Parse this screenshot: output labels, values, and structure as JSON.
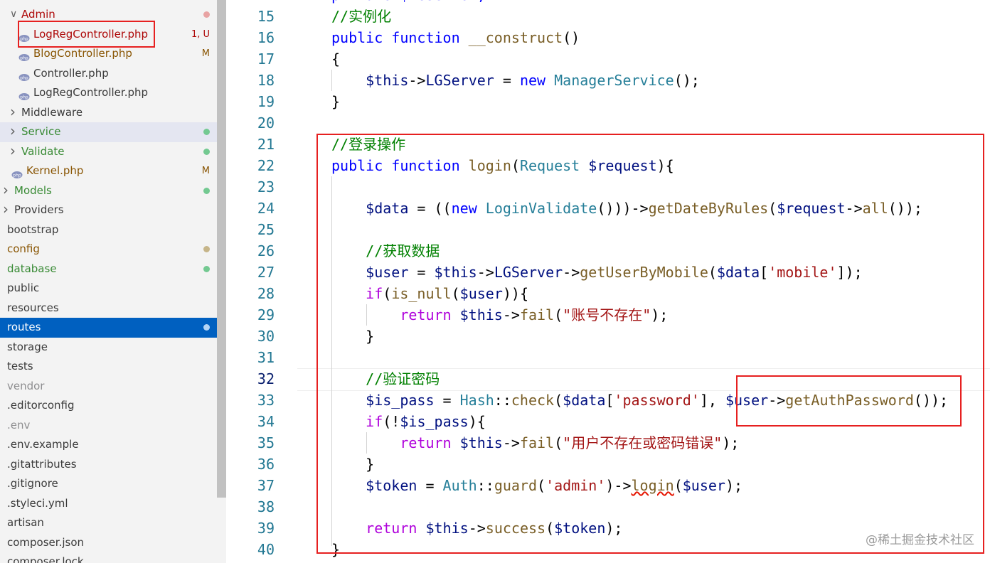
{
  "sidebar": {
    "items": [
      {
        "label": "Admin",
        "indent": 1,
        "chevron": "down",
        "color": "#ad0707",
        "dot": "#e8a3a3"
      },
      {
        "label": "LogRegController.php",
        "indent": 2,
        "icon": "php-icon",
        "color": "#ad0707",
        "badge": "1, U"
      },
      {
        "label": "BlogController.php",
        "indent": 2,
        "icon": "php-icon",
        "color": "#895503",
        "badge": "M"
      },
      {
        "label": "Controller.php",
        "indent": 2,
        "icon": "php-icon"
      },
      {
        "label": "LogRegController.php",
        "indent": 2,
        "icon": "php-icon"
      },
      {
        "label": "Middleware",
        "indent": 1,
        "chevron": "right"
      },
      {
        "label": "Service",
        "indent": 1,
        "chevron": "right",
        "color": "#388a34",
        "dot": "#73c991"
      },
      {
        "label": "Validate",
        "indent": 1,
        "chevron": "right",
        "color": "#388a34",
        "dot": "#73c991"
      },
      {
        "label": "Kernel.php",
        "indent": 1,
        "icon": "php-icon",
        "color": "#895503",
        "badge": "M"
      },
      {
        "label": "Models",
        "indent": 0,
        "chevron": "right",
        "color": "#388a34",
        "dot": "#73c991"
      },
      {
        "label": "Providers",
        "indent": 0,
        "chevron": "right"
      },
      {
        "label": "bootstrap",
        "indent": 0
      },
      {
        "label": "config",
        "indent": 0,
        "color": "#895503",
        "dot": "#c6b589"
      },
      {
        "label": "database",
        "indent": 0,
        "color": "#388a34",
        "dot": "#73c991"
      },
      {
        "label": "public",
        "indent": 0
      },
      {
        "label": "resources",
        "indent": 0
      },
      {
        "label": "routes",
        "indent": 0,
        "selected": true,
        "dot": "#b3d4f5"
      },
      {
        "label": "storage",
        "indent": 0
      },
      {
        "label": "tests",
        "indent": 0
      },
      {
        "label": "vendor",
        "indent": 0,
        "color": "#8e8e90"
      },
      {
        "label": ".editorconfig",
        "indent": 0
      },
      {
        "label": ".env",
        "indent": 0,
        "color": "#8e8e90"
      },
      {
        "label": ".env.example",
        "indent": 0
      },
      {
        "label": ".gitattributes",
        "indent": 0
      },
      {
        "label": ".gitignore",
        "indent": 0
      },
      {
        "label": ".styleci.yml",
        "indent": 0
      },
      {
        "label": "artisan",
        "indent": 0
      },
      {
        "label": "composer.json",
        "indent": 0
      },
      {
        "label": "composer.lock",
        "indent": 0
      }
    ]
  },
  "editor": {
    "lines": [
      {
        "num": "14",
        "tokens": [
          {
            "t": "private $LGServer;",
            "c": "kw"
          }
        ]
      },
      {
        "num": "15",
        "tokens": [
          {
            "t": "//实例化",
            "c": "cm"
          }
        ]
      },
      {
        "num": "16",
        "tokens": [
          {
            "t": "public",
            "c": "kw"
          },
          {
            "t": " "
          },
          {
            "t": "function",
            "c": "kw"
          },
          {
            "t": " "
          },
          {
            "t": "__construct",
            "c": "fn"
          },
          {
            "t": "()"
          }
        ]
      },
      {
        "num": "17",
        "tokens": [
          {
            "t": "{"
          }
        ]
      },
      {
        "num": "18",
        "tokens": [
          {
            "t": "    "
          },
          {
            "t": "$this",
            "c": "var"
          },
          {
            "t": "->"
          },
          {
            "t": "LGServer",
            "c": "var"
          },
          {
            "t": " = "
          },
          {
            "t": "new",
            "c": "kw"
          },
          {
            "t": " "
          },
          {
            "t": "ManagerService",
            "c": "cls"
          },
          {
            "t": "();"
          }
        ]
      },
      {
        "num": "19",
        "tokens": [
          {
            "t": "}"
          }
        ]
      },
      {
        "num": "20",
        "tokens": []
      },
      {
        "num": "21",
        "tokens": [
          {
            "t": "//登录操作",
            "c": "cm"
          }
        ]
      },
      {
        "num": "22",
        "tokens": [
          {
            "t": "public",
            "c": "kw"
          },
          {
            "t": " "
          },
          {
            "t": "function",
            "c": "kw"
          },
          {
            "t": " "
          },
          {
            "t": "login",
            "c": "fn"
          },
          {
            "t": "("
          },
          {
            "t": "Request",
            "c": "cls"
          },
          {
            "t": " "
          },
          {
            "t": "$request",
            "c": "var"
          },
          {
            "t": "){"
          }
        ]
      },
      {
        "num": "23",
        "tokens": []
      },
      {
        "num": "24",
        "tokens": [
          {
            "t": "    "
          },
          {
            "t": "$data",
            "c": "var"
          },
          {
            "t": " = (("
          },
          {
            "t": "new",
            "c": "kw"
          },
          {
            "t": " "
          },
          {
            "t": "LoginValidate",
            "c": "cls"
          },
          {
            "t": "()))->"
          },
          {
            "t": "getDateByRules",
            "c": "fn"
          },
          {
            "t": "("
          },
          {
            "t": "$request",
            "c": "var"
          },
          {
            "t": "->"
          },
          {
            "t": "all",
            "c": "fn"
          },
          {
            "t": "());"
          }
        ]
      },
      {
        "num": "25",
        "tokens": []
      },
      {
        "num": "26",
        "tokens": [
          {
            "t": "    "
          },
          {
            "t": "//获取数据",
            "c": "cm"
          }
        ]
      },
      {
        "num": "27",
        "tokens": [
          {
            "t": "    "
          },
          {
            "t": "$user",
            "c": "var"
          },
          {
            "t": " = "
          },
          {
            "t": "$this",
            "c": "var"
          },
          {
            "t": "->"
          },
          {
            "t": "LGServer",
            "c": "var"
          },
          {
            "t": "->"
          },
          {
            "t": "getUserByMobile",
            "c": "fn"
          },
          {
            "t": "("
          },
          {
            "t": "$data",
            "c": "var"
          },
          {
            "t": "["
          },
          {
            "t": "'mobile'",
            "c": "str"
          },
          {
            "t": "]);"
          }
        ]
      },
      {
        "num": "28",
        "tokens": [
          {
            "t": "    "
          },
          {
            "t": "if",
            "c": "kw2"
          },
          {
            "t": "("
          },
          {
            "t": "is_null",
            "c": "fn"
          },
          {
            "t": "("
          },
          {
            "t": "$user",
            "c": "var"
          },
          {
            "t": ")){"
          }
        ]
      },
      {
        "num": "29",
        "tokens": [
          {
            "t": "        "
          },
          {
            "t": "return",
            "c": "kw2"
          },
          {
            "t": " "
          },
          {
            "t": "$this",
            "c": "var"
          },
          {
            "t": "->"
          },
          {
            "t": "fail",
            "c": "fn"
          },
          {
            "t": "("
          },
          {
            "t": "\"账号不存在\"",
            "c": "str"
          },
          {
            "t": ");"
          }
        ]
      },
      {
        "num": "30",
        "tokens": [
          {
            "t": "    }"
          }
        ]
      },
      {
        "num": "31",
        "tokens": []
      },
      {
        "num": "32",
        "tokens": [
          {
            "t": "    "
          },
          {
            "t": "//验证密码",
            "c": "cm"
          }
        ]
      },
      {
        "num": "33",
        "tokens": [
          {
            "t": "    "
          },
          {
            "t": "$is_pass",
            "c": "var"
          },
          {
            "t": " = "
          },
          {
            "t": "Hash",
            "c": "cls"
          },
          {
            "t": "::"
          },
          {
            "t": "check",
            "c": "fn"
          },
          {
            "t": "("
          },
          {
            "t": "$data",
            "c": "var"
          },
          {
            "t": "["
          },
          {
            "t": "'password'",
            "c": "str"
          },
          {
            "t": "], "
          },
          {
            "t": "$user",
            "c": "var"
          },
          {
            "t": "->"
          },
          {
            "t": "getAuthPassword",
            "c": "fn"
          },
          {
            "t": "());"
          }
        ]
      },
      {
        "num": "34",
        "tokens": [
          {
            "t": "    "
          },
          {
            "t": "if",
            "c": "kw2"
          },
          {
            "t": "(!"
          },
          {
            "t": "$is_pass",
            "c": "var"
          },
          {
            "t": "){"
          }
        ]
      },
      {
        "num": "35",
        "tokens": [
          {
            "t": "        "
          },
          {
            "t": "return",
            "c": "kw2"
          },
          {
            "t": " "
          },
          {
            "t": "$this",
            "c": "var"
          },
          {
            "t": "->"
          },
          {
            "t": "fail",
            "c": "fn"
          },
          {
            "t": "("
          },
          {
            "t": "\"用户不存在或密码错误\"",
            "c": "str"
          },
          {
            "t": ");"
          }
        ]
      },
      {
        "num": "36",
        "tokens": [
          {
            "t": "    }"
          }
        ]
      },
      {
        "num": "37",
        "tokens": [
          {
            "t": "    "
          },
          {
            "t": "$token",
            "c": "var"
          },
          {
            "t": " = "
          },
          {
            "t": "Auth",
            "c": "cls"
          },
          {
            "t": "::"
          },
          {
            "t": "guard",
            "c": "fn"
          },
          {
            "t": "("
          },
          {
            "t": "'admin'",
            "c": "str"
          },
          {
            "t": ")->"
          },
          {
            "t": "login",
            "c": "fn squig"
          },
          {
            "t": "("
          },
          {
            "t": "$user",
            "c": "var"
          },
          {
            "t": ");"
          }
        ]
      },
      {
        "num": "38",
        "tokens": []
      },
      {
        "num": "39",
        "tokens": [
          {
            "t": "    "
          },
          {
            "t": "return",
            "c": "kw2"
          },
          {
            "t": " "
          },
          {
            "t": "$this",
            "c": "var"
          },
          {
            "t": "->"
          },
          {
            "t": "success",
            "c": "fn"
          },
          {
            "t": "("
          },
          {
            "t": "$token",
            "c": "var"
          },
          {
            "t": ");"
          }
        ]
      },
      {
        "num": "40",
        "tokens": [
          {
            "t": "}"
          }
        ]
      }
    ]
  },
  "watermark": "@稀土掘金技术社区",
  "colors": {
    "annotation_red": "#e62020",
    "selection_blue": "#0060c0"
  }
}
